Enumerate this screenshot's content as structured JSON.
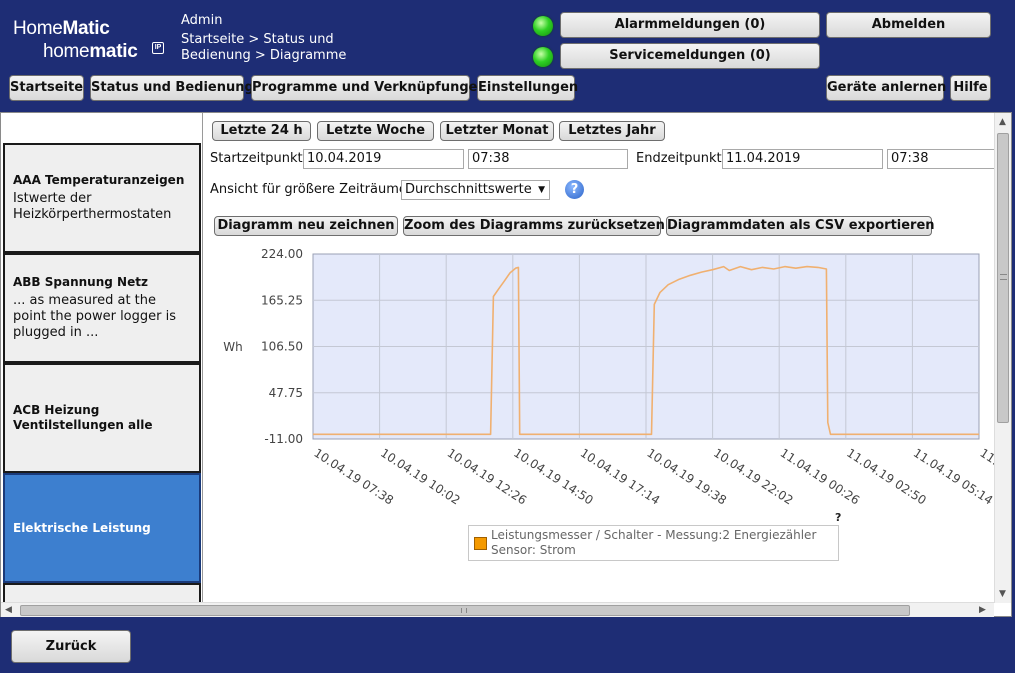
{
  "header": {
    "logo_line1_a": "Home",
    "logo_line1_b": "Matic",
    "logo_line2_a": "home",
    "logo_line2_b": "matic",
    "logo_badge": "IP",
    "user": "Admin",
    "breadcrumb": "Startseite > Status und Bedienung > Diagramme",
    "alarm_button": "Alarmmeldungen (0)",
    "service_button": "Servicemeldungen (0)",
    "logout_button": "Abmelden",
    "led_color": "#2ed023"
  },
  "nav": {
    "home": "Startseite",
    "status": "Status und Bedienung",
    "programs": "Programme und Verknüpfungen",
    "settings": "Einstellungen",
    "teach": "Geräte anlernen",
    "help": "Hilfe"
  },
  "sidebar": {
    "items": [
      {
        "title": "AAA Temperaturanzeigen",
        "desc": "Istwerte der Heizkörperthermostaten"
      },
      {
        "title": "ABB Spannung Netz",
        "desc": "... as measured at the point the power logger is plugged in ..."
      },
      {
        "title": "ACB Heizung Ventilstellungen alle",
        "desc": ""
      },
      {
        "title": "Elektrische Leistung",
        "desc": "",
        "active": true
      }
    ],
    "active_color": "#3d7fcf"
  },
  "range_buttons": {
    "day": "Letzte 24 h",
    "week": "Letzte Woche",
    "month": "Letzter Monat",
    "year": "Letztes Jahr"
  },
  "period": {
    "start_label": "Startzeitpunkt",
    "start_date": "10.04.2019",
    "start_time": "07:38",
    "end_label": "Endzeitpunkt",
    "end_date": "11.04.2019",
    "end_time": "07:38"
  },
  "view": {
    "label": "Ansicht für größere Zeiträume",
    "selected": "Durchschnittswerte",
    "help_icon": "help-icon"
  },
  "actions": {
    "redraw": "Diagramm neu zeichnen",
    "reset_zoom": "Zoom des Diagramms zurücksetzen",
    "export_csv": "Diagrammdaten als CSV exportieren"
  },
  "legend_help": "?",
  "footer": {
    "back": "Zurück"
  },
  "chart_data": {
    "type": "line",
    "ylabel": "Wh",
    "ylim": [
      -11.0,
      224.0
    ],
    "y_ticks": [
      "224.00",
      "165.25",
      "106.50",
      "47.75",
      "-11.00"
    ],
    "x_ticks": [
      "10.04.19 07:38",
      "10.04.19 10:02",
      "10.04.19 12:26",
      "10.04.19 14:50",
      "10.04.19 17:14",
      "10.04.19 19:38",
      "10.04.19 22:02",
      "11.04.19 00:26",
      "11.04.19 02:50",
      "11.04.19 05:14",
      "11."
    ],
    "x_range_hours": [
      0,
      24
    ],
    "grid": true,
    "line_color": "#f0b070",
    "plot_background": "#e4e9fa",
    "legend": "bottom",
    "series": [
      {
        "name": "Leistungsmesser / Schalter - Messung:2 Energiezähler Sensor: Strom",
        "legend_color": "#f59a00",
        "points": [
          [
            0.0,
            -5
          ],
          [
            6.4,
            -5
          ],
          [
            6.5,
            170
          ],
          [
            6.7,
            180
          ],
          [
            6.9,
            190
          ],
          [
            7.1,
            200
          ],
          [
            7.3,
            206
          ],
          [
            7.4,
            207
          ],
          [
            7.45,
            -5
          ],
          [
            12.2,
            -5
          ],
          [
            12.3,
            160
          ],
          [
            12.5,
            175
          ],
          [
            12.8,
            185
          ],
          [
            13.2,
            192
          ],
          [
            13.6,
            197
          ],
          [
            14.0,
            201
          ],
          [
            14.4,
            204
          ],
          [
            14.8,
            208
          ],
          [
            15.0,
            203
          ],
          [
            15.4,
            208
          ],
          [
            15.8,
            204
          ],
          [
            16.2,
            207
          ],
          [
            16.6,
            205
          ],
          [
            17.0,
            208
          ],
          [
            17.4,
            206
          ],
          [
            17.8,
            208
          ],
          [
            18.2,
            207
          ],
          [
            18.5,
            205
          ],
          [
            18.55,
            10
          ],
          [
            18.65,
            -5
          ],
          [
            24.0,
            -5
          ]
        ]
      }
    ]
  }
}
